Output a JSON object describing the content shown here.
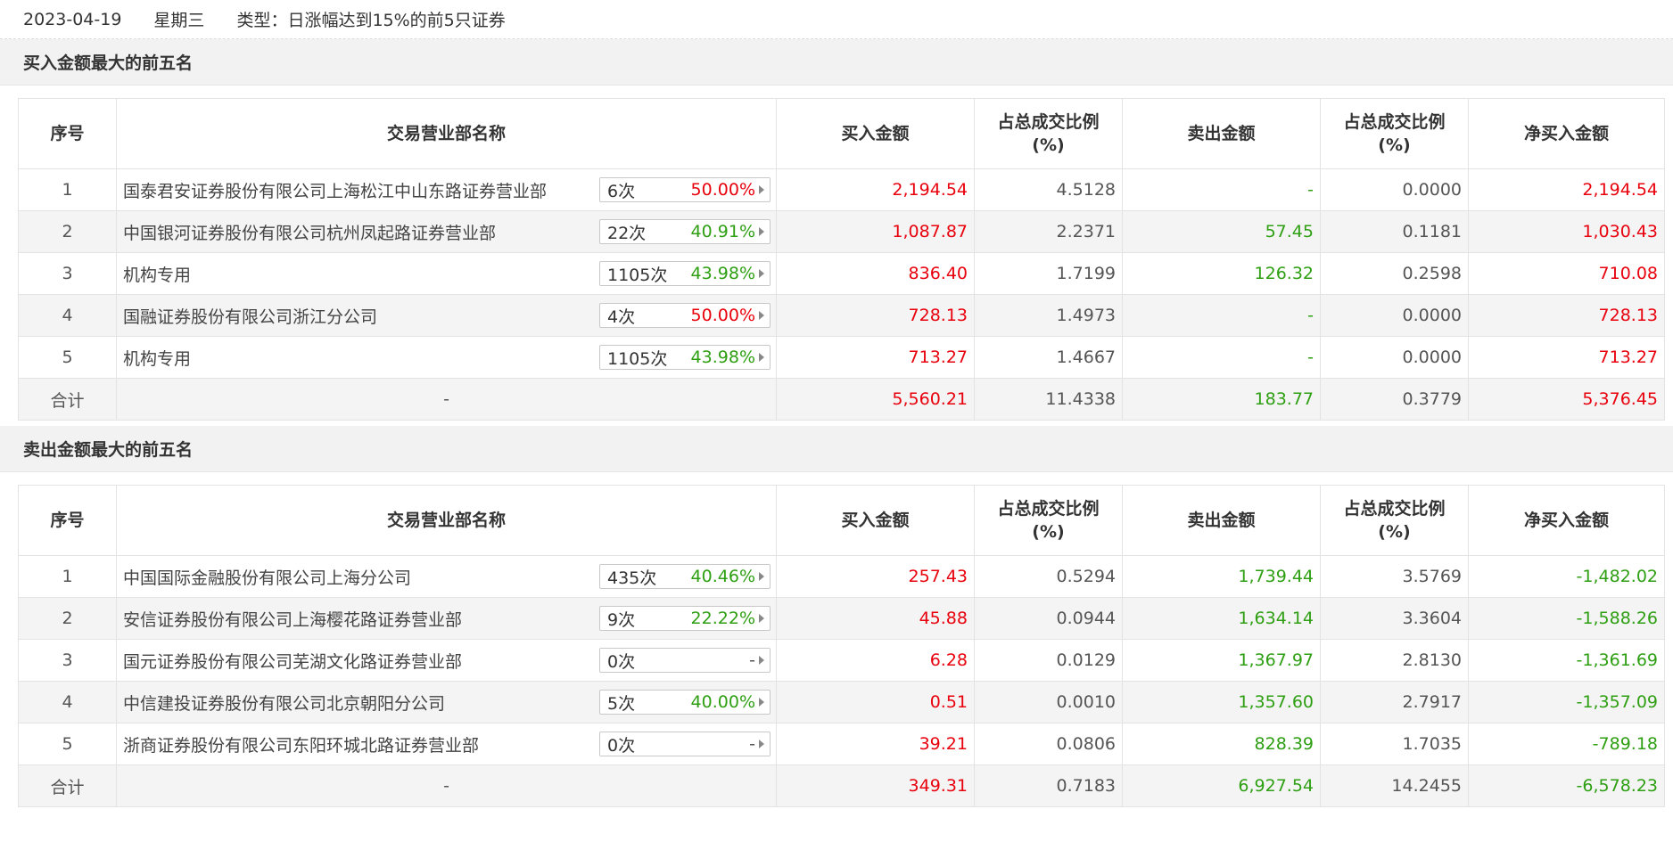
{
  "topbar": {
    "date": "2023-04-19",
    "weekday": "星期三",
    "type": "类型：日涨幅达到15%的前5只证券"
  },
  "headers": {
    "seq": "序号",
    "name": "交易营业部名称",
    "buy": "买入金额",
    "buy_pct_l1": "占总成交比例",
    "buy_pct_l2": "(%)",
    "sell": "卖出金额",
    "sell_pct_l1": "占总成交比例",
    "sell_pct_l2": "(%)",
    "net": "净买入金额"
  },
  "buy_section": {
    "title": "买入金额最大的前五名",
    "rows": [
      {
        "seq": "1",
        "name": "国泰君安证券股份有限公司上海松江中山东路证券营业部",
        "times": "6次",
        "rate": "50.00%",
        "rate_color": "red",
        "buy": "2,194.54",
        "buy_pct": "4.5128",
        "sell": "-",
        "sell_pct": "0.0000",
        "net": "2,194.54",
        "net_color": "red"
      },
      {
        "seq": "2",
        "name": "中国银河证券股份有限公司杭州凤起路证券营业部",
        "times": "22次",
        "rate": "40.91%",
        "rate_color": "green",
        "buy": "1,087.87",
        "buy_pct": "2.2371",
        "sell": "57.45",
        "sell_pct": "0.1181",
        "net": "1,030.43",
        "net_color": "red"
      },
      {
        "seq": "3",
        "name": "机构专用",
        "times": "1105次",
        "rate": "43.98%",
        "rate_color": "green",
        "buy": "836.40",
        "buy_pct": "1.7199",
        "sell": "126.32",
        "sell_pct": "0.2598",
        "net": "710.08",
        "net_color": "red"
      },
      {
        "seq": "4",
        "name": "国融证券股份有限公司浙江分公司",
        "times": "4次",
        "rate": "50.00%",
        "rate_color": "red",
        "buy": "728.13",
        "buy_pct": "1.4973",
        "sell": "-",
        "sell_pct": "0.0000",
        "net": "728.13",
        "net_color": "red"
      },
      {
        "seq": "5",
        "name": "机构专用",
        "times": "1105次",
        "rate": "43.98%",
        "rate_color": "green",
        "buy": "713.27",
        "buy_pct": "1.4667",
        "sell": "-",
        "sell_pct": "0.0000",
        "net": "713.27",
        "net_color": "red"
      }
    ],
    "total": {
      "label": "合计",
      "name": "-",
      "buy": "5,560.21",
      "buy_pct": "11.4338",
      "sell": "183.77",
      "sell_pct": "0.3779",
      "net": "5,376.45",
      "net_color": "red"
    }
  },
  "sell_section": {
    "title": "卖出金额最大的前五名",
    "rows": [
      {
        "seq": "1",
        "name": "中国国际金融股份有限公司上海分公司",
        "times": "435次",
        "rate": "40.46%",
        "rate_color": "green",
        "buy": "257.43",
        "buy_pct": "0.5294",
        "sell": "1,739.44",
        "sell_pct": "3.5769",
        "net": "-1,482.02",
        "net_color": "green"
      },
      {
        "seq": "2",
        "name": "安信证券股份有限公司上海樱花路证券营业部",
        "times": "9次",
        "rate": "22.22%",
        "rate_color": "green",
        "buy": "45.88",
        "buy_pct": "0.0944",
        "sell": "1,634.14",
        "sell_pct": "3.3604",
        "net": "-1,588.26",
        "net_color": "green"
      },
      {
        "seq": "3",
        "name": "国元证券股份有限公司芜湖文化路证券营业部",
        "times": "0次",
        "rate": "-",
        "rate_color": "gray",
        "buy": "6.28",
        "buy_pct": "0.0129",
        "sell": "1,367.97",
        "sell_pct": "2.8130",
        "net": "-1,361.69",
        "net_color": "green"
      },
      {
        "seq": "4",
        "name": "中信建投证券股份有限公司北京朝阳分公司",
        "times": "5次",
        "rate": "40.00%",
        "rate_color": "green",
        "buy": "0.51",
        "buy_pct": "0.0010",
        "sell": "1,357.60",
        "sell_pct": "2.7917",
        "net": "-1,357.09",
        "net_color": "green"
      },
      {
        "seq": "5",
        "name": "浙商证券股份有限公司东阳环城北路证券营业部",
        "times": "0次",
        "rate": "-",
        "rate_color": "gray",
        "buy": "39.21",
        "buy_pct": "0.0806",
        "sell": "828.39",
        "sell_pct": "1.7035",
        "net": "-789.18",
        "net_color": "green"
      }
    ],
    "total": {
      "label": "合计",
      "name": "-",
      "buy": "349.31",
      "buy_pct": "0.7183",
      "sell": "6,927.54",
      "sell_pct": "14.2455",
      "net": "-6,578.23",
      "net_color": "green"
    }
  },
  "colors": {
    "red": "#e8000d",
    "green": "#2e9f12",
    "gray": "#555555"
  },
  "icons": {
    "tag_arrow": "triangle-right-icon"
  }
}
